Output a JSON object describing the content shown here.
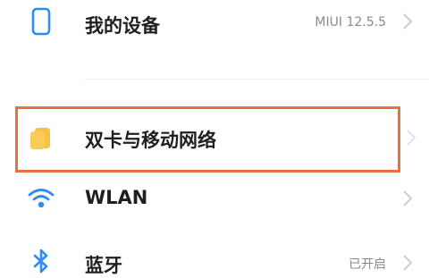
{
  "settings": {
    "items": [
      {
        "label": "我的设备",
        "value": "MIUI 12.5.5",
        "icon": "phone-icon"
      },
      {
        "label": "双卡与移动网络",
        "value": "",
        "icon": "sim-card-icon"
      },
      {
        "label": "WLAN",
        "value": "",
        "icon": "wifi-icon"
      },
      {
        "label": "蓝牙",
        "value": "已开启",
        "icon": "bluetooth-icon"
      }
    ]
  },
  "colors": {
    "highlight": "#e8703f",
    "sim_icon": "#f6c146",
    "icon_blue": "#2f8cf1"
  }
}
